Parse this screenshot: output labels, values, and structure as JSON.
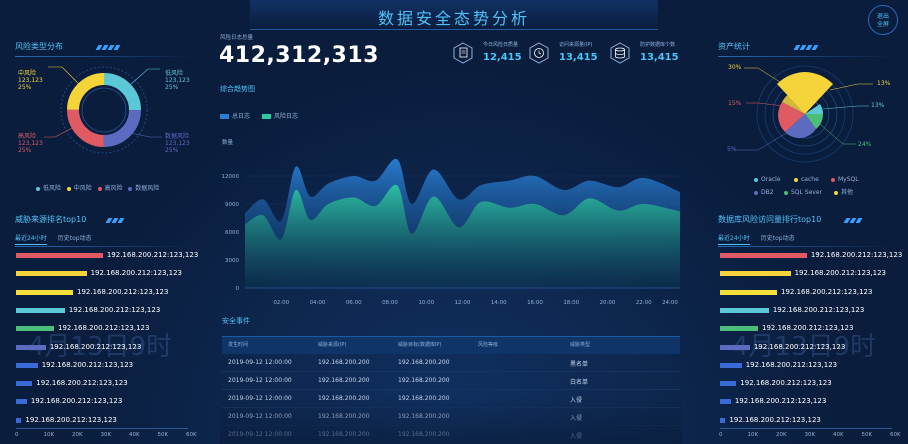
{
  "title": "数据安全态势分析",
  "exit_button": {
    "l1": "退出",
    "l2": "全屏"
  },
  "watermark": "4月13日9时",
  "risk_dist": {
    "title": "风险类型分布",
    "slices": [
      {
        "name": "低风险",
        "value": "123,123",
        "pct": "25%",
        "color": "#5bc8d8"
      },
      {
        "name": "中风险",
        "value": "123,123",
        "pct": "25%",
        "color": "#f5d43a"
      },
      {
        "name": "高风险",
        "value": "123,123",
        "pct": "25%",
        "color": "#e05a63"
      },
      {
        "name": "数据风险",
        "value": "123,123",
        "pct": "25%",
        "color": "#5c6bc0"
      }
    ]
  },
  "threat_rank": {
    "title": "威胁来源排名top10",
    "tabs": [
      "最近24小时",
      "历史top动态"
    ],
    "items": [
      {
        "label": "192.168.200.212:123,123",
        "value": 32,
        "color": "#e05a63"
      },
      {
        "label": "192.168.200.212:123,123",
        "value": 26,
        "color": "#f5d43a"
      },
      {
        "label": "192.168.200.212:123,123",
        "value": 21,
        "color": "#f5e03a"
      },
      {
        "label": "192.168.200.212:123,123",
        "value": 18,
        "color": "#5bc8d8"
      },
      {
        "label": "192.168.200.212:123,123",
        "value": 14,
        "color": "#4bbf7a"
      },
      {
        "label": "192.168.200.212:123,123",
        "value": 11,
        "color": "#5c6bc0"
      },
      {
        "label": "192.168.200.212:123,123",
        "value": 8,
        "color": "#3a6ad8"
      },
      {
        "label": "192.168.200.212:123,123",
        "value": 6,
        "color": "#3a6ad8"
      },
      {
        "label": "192.168.200.212:123,123",
        "value": 4,
        "color": "#3a6ad8"
      },
      {
        "label": "192.168.200.212:123,123",
        "value": 2,
        "color": "#3a6ad8"
      }
    ],
    "axis": [
      "0",
      "10K",
      "20K",
      "30K",
      "40K",
      "50K",
      "60K"
    ]
  },
  "log_total": {
    "label": "风险日志总量",
    "value": "412,312,313"
  },
  "stats": [
    {
      "label": "今日风险日质量",
      "value": "12,415",
      "icon": "doc-icon"
    },
    {
      "label": "访问来源量(IP)",
      "value": "13,415",
      "icon": "clock-icon"
    },
    {
      "label": "防护数据库个数",
      "value": "13,415",
      "icon": "database-icon"
    }
  ],
  "trend": {
    "title": "综合趋势图",
    "ylabel": "数量",
    "chart_data": {
      "type": "area",
      "x": [
        "02:00",
        "04:00",
        "06:00",
        "08:00",
        "10:00",
        "12:00",
        "14:00",
        "16:00",
        "18:00",
        "20:00",
        "22:00",
        "24:00"
      ],
      "yticks": [
        "12000",
        "9000",
        "6000",
        "3000",
        "0"
      ],
      "ylim": [
        0,
        15000
      ],
      "series": [
        {
          "name": "总日志",
          "color": "#2a7fd4",
          "points": [
            [
              0,
              8000
            ],
            [
              0.5,
              9500
            ],
            [
              1,
              7200
            ],
            [
              1.4,
              13000
            ],
            [
              1.8,
              9800
            ],
            [
              2.3,
              11200
            ],
            [
              3,
              12000
            ],
            [
              3.6,
              11500
            ],
            [
              4.2,
              13800
            ],
            [
              4.6,
              9000
            ],
            [
              5.2,
              12700
            ],
            [
              5.9,
              9500
            ],
            [
              6.5,
              11000
            ],
            [
              7.3,
              11500
            ],
            [
              8,
              12000
            ],
            [
              8.8,
              10500
            ],
            [
              9.5,
              11500
            ],
            [
              10.3,
              10800
            ],
            [
              11,
              11800
            ],
            [
              12,
              10300
            ]
          ]
        },
        {
          "name": "风险日志",
          "color": "#2ec9a0",
          "points": [
            [
              0,
              6800
            ],
            [
              0.5,
              7800
            ],
            [
              1,
              5200
            ],
            [
              1.4,
              10500
            ],
            [
              1.8,
              7300
            ],
            [
              2.3,
              9000
            ],
            [
              3,
              9700
            ],
            [
              3.6,
              8800
            ],
            [
              4.2,
              11000
            ],
            [
              4.6,
              5800
            ],
            [
              5.2,
              9800
            ],
            [
              5.9,
              6500
            ],
            [
              6.5,
              9200
            ],
            [
              7.3,
              8600
            ],
            [
              8,
              9000
            ],
            [
              8.8,
              7800
            ],
            [
              9.5,
              9600
            ],
            [
              10.3,
              8300
            ],
            [
              11,
              9000
            ],
            [
              12,
              8200
            ]
          ]
        }
      ]
    }
  },
  "events": {
    "title": "安全事件",
    "headers": [
      "发生时间",
      "威胁来源(IP)",
      "威胁目标(数据库IP)",
      "风险等级",
      "威胁类型"
    ],
    "rows": [
      [
        "2019-09-12 12:00:00",
        "192.168.200.200",
        "192.168.200.200",
        "",
        "黑名单"
      ],
      [
        "2019-09-12 12:00:00",
        "192.168.200.200",
        "192.168.200.200",
        "",
        "白名单"
      ],
      [
        "2019-09-12 12:00:00",
        "192.168.200.200",
        "192.168.200.200",
        "",
        "入侵"
      ],
      [
        "2019-09-12 12:00:00",
        "192.168.200.200",
        "192.168.200.200",
        "",
        "入侵"
      ],
      [
        "2019-09-12 12:00:00",
        "192.168.200.200",
        "192.168.200.200",
        "",
        "入侵"
      ]
    ]
  },
  "assets": {
    "title": "资产统计",
    "labels": [
      {
        "pct": "30%",
        "color": "#f5d43a"
      },
      {
        "pct": "13%",
        "color": "#f5d43a"
      },
      {
        "pct": "15%",
        "color": "#e05a63"
      },
      {
        "pct": "13%",
        "color": "#5bc8d8"
      },
      {
        "pct": "24%",
        "color": "#4bbf7a"
      },
      {
        "pct": "5%",
        "color": "#5c6bc0"
      }
    ],
    "legend": [
      {
        "name": "Oracle",
        "color": "#5bc8d8"
      },
      {
        "name": "cache",
        "color": "#f5d43a"
      },
      {
        "name": "MySQL",
        "color": "#e05a63"
      },
      {
        "name": "DB2",
        "color": "#5c6bc0"
      },
      {
        "name": "SQL Sever",
        "color": "#4bbf7a"
      },
      {
        "name": "其他",
        "color": "#f5d43a"
      }
    ]
  },
  "db_rank": {
    "title": "数据库风险访问量排行top10",
    "tabs": [
      "最近24小时",
      "历史top动态"
    ],
    "items": [
      {
        "label": "192.168.200.212:123,123",
        "value": 32,
        "color": "#e05a63"
      },
      {
        "label": "192.168.200.212:123,123",
        "value": 26,
        "color": "#f5d43a"
      },
      {
        "label": "192.168.200.212:123,123",
        "value": 21,
        "color": "#f5e03a"
      },
      {
        "label": "192.168.200.212:123,123",
        "value": 18,
        "color": "#5bc8d8"
      },
      {
        "label": "192.168.200.212:123,123",
        "value": 14,
        "color": "#4bbf7a"
      },
      {
        "label": "192.168.200.212:123,123",
        "value": 11,
        "color": "#5c6bc0"
      },
      {
        "label": "192.168.200.212:123,123",
        "value": 8,
        "color": "#3a6ad8"
      },
      {
        "label": "192.168.200.212:123,123",
        "value": 6,
        "color": "#3a6ad8"
      },
      {
        "label": "192.168.200.212:123,123",
        "value": 4,
        "color": "#3a6ad8"
      },
      {
        "label": "192.168.200.212:123,123",
        "value": 2,
        "color": "#3a6ad8"
      }
    ],
    "axis": [
      "0",
      "10K",
      "20K",
      "30K",
      "40K",
      "50K",
      "60K"
    ]
  }
}
